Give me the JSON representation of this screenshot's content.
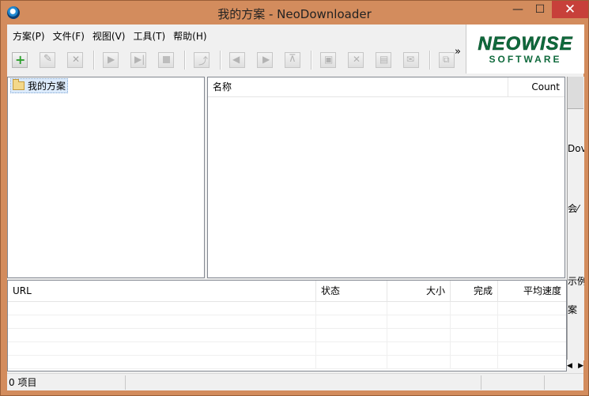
{
  "window": {
    "title": "我的方案 - NeoDownloader",
    "minimize_glyph": "—",
    "maximize_glyph": "☐",
    "close_glyph": "✕"
  },
  "menu": [
    "方案(P)",
    "文件(F)",
    "视图(V)",
    "工具(T)",
    "帮助(H)"
  ],
  "toolbar": {
    "buttons": [
      "new-project-icon",
      "edit-icon",
      "delete-icon",
      "start-icon",
      "step-icon",
      "stop-icon",
      "import-icon",
      "back-icon",
      "forward-icon",
      "slideshow-icon",
      "window-icon",
      "remove-icon",
      "view-icon",
      "mail-icon",
      "fullscreen-icon"
    ],
    "more_label": "»"
  },
  "logo": {
    "line1": "NEOWISE",
    "line2": "SOFTWARE",
    "color": "#0f6a3c"
  },
  "tree": {
    "root_label": "我的方案"
  },
  "list": {
    "col_name": "名称",
    "col_count": "Count"
  },
  "cut_pane": {
    "t1": "Dov",
    "t2": "会⁄",
    "t3": "示例",
    "t4": "案"
  },
  "downloads": {
    "col_url": "URL",
    "col_status": "状态",
    "col_size": "大小",
    "col_done": "完成",
    "col_speed": "平均速度"
  },
  "status": {
    "items": "0 项目"
  }
}
